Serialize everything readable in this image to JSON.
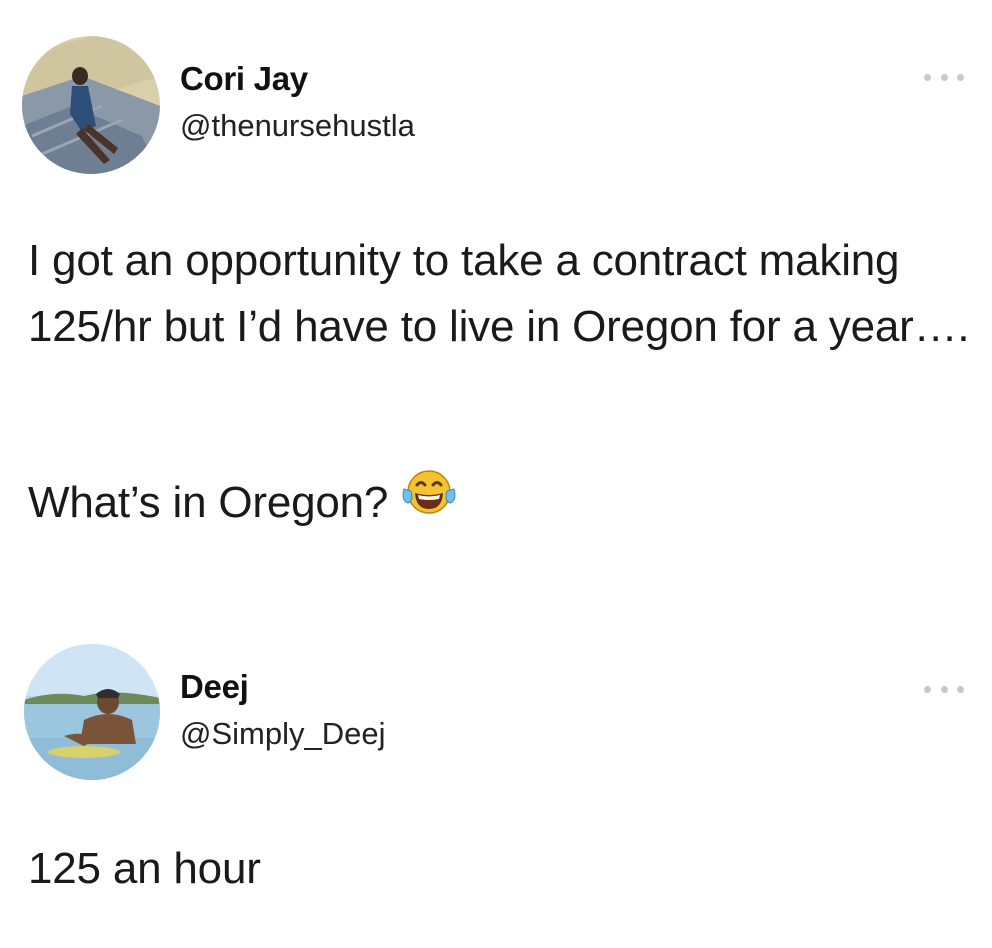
{
  "tweets": [
    {
      "display_name": "Cori Jay",
      "handle": "@thenursehustla",
      "paragraphs": [
        "I got an opportunity to take a contract making 125/hr but I’d have to live in Oregon for a year….",
        "What’s in Oregon?"
      ],
      "trailing_emoji": "face-with-tears-of-joy-icon",
      "more_icon": "more-options-icon"
    },
    {
      "display_name": "Deej",
      "handle": "@Simply_Deej",
      "paragraphs": [
        "125 an hour"
      ],
      "more_icon": "more-options-icon"
    }
  ],
  "colors": {
    "background": "#ffffff",
    "text": "#1a1a1a",
    "handle": "#222222",
    "more_dots": "#c8c8c8"
  }
}
